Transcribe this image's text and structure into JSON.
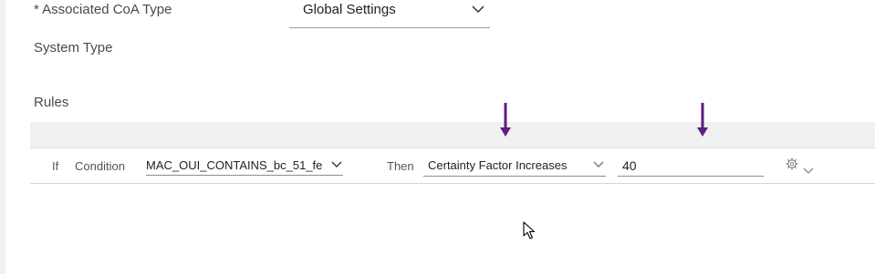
{
  "form": {
    "coa_label": "* Associated CoA Type",
    "coa_value": "Global Settings",
    "system_type_label": "System Type",
    "rules_label": "Rules"
  },
  "rule": {
    "if_label": "If",
    "condition_label": "Condition",
    "condition_value": "MAC_OUI_CONTAINS_bc_51_fe",
    "then_label": "Then",
    "then_value": "Certainty Factor Increases",
    "factor_value": "40"
  },
  "colors": {
    "annotation_arrow": "#5b1f7f"
  },
  "icons": [
    "chevron-down-icon",
    "gear-icon",
    "arrow-down-icon",
    "mouse-cursor-icon"
  ]
}
